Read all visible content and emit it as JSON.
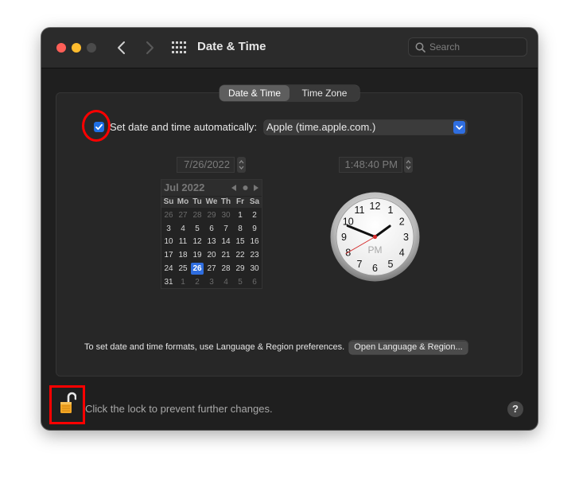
{
  "window": {
    "title": "Date & Time",
    "search_placeholder": "Search"
  },
  "tabs": [
    {
      "label": "Date & Time",
      "active": true
    },
    {
      "label": "Time Zone",
      "active": false
    }
  ],
  "auto_time": {
    "checked": true,
    "label": "Set date and time automatically:",
    "server": "Apple (time.apple.com.)"
  },
  "date_field": "7/26/2022",
  "time_field": "1:48:40 PM",
  "calendar": {
    "month_label": "Jul 2022",
    "weekdays": [
      "Su",
      "Mo",
      "Tu",
      "We",
      "Th",
      "Fr",
      "Sa"
    ],
    "weeks": [
      [
        "26",
        "27",
        "28",
        "29",
        "30",
        "1",
        "2"
      ],
      [
        "3",
        "4",
        "5",
        "6",
        "7",
        "8",
        "9"
      ],
      [
        "10",
        "11",
        "12",
        "13",
        "14",
        "15",
        "16"
      ],
      [
        "17",
        "18",
        "19",
        "20",
        "21",
        "22",
        "23"
      ],
      [
        "24",
        "25",
        "26",
        "27",
        "28",
        "29",
        "30"
      ],
      [
        "31",
        "1",
        "2",
        "3",
        "4",
        "5",
        "6"
      ]
    ],
    "selected_day": "26"
  },
  "clock": {
    "numbers": [
      "12",
      "1",
      "2",
      "3",
      "4",
      "5",
      "6",
      "7",
      "8",
      "9",
      "10",
      "11"
    ],
    "period": "PM",
    "hours": 1,
    "minutes": 48,
    "seconds": 40
  },
  "formats": {
    "text": "To set date and time formats, use Language & Region preferences.",
    "button_label": "Open Language & Region..."
  },
  "lock": {
    "text": "Click the lock to prevent further changes."
  },
  "help_label": "?",
  "colors": {
    "accent": "#2f6ee0",
    "annotation": "#ff0000",
    "lock_body": "#f2a624"
  }
}
